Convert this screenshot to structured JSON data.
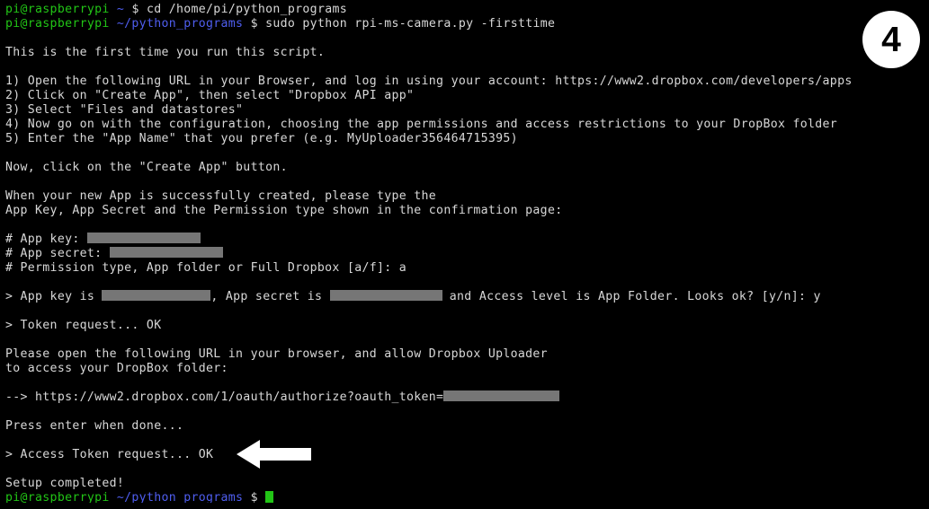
{
  "badge": {
    "label": "4"
  },
  "prompt": {
    "user": "pi@raspberrypi",
    "path_home": "~",
    "path_programs": "~/python_programs",
    "symbol": "$"
  },
  "commands": {
    "cd": "cd /home/pi/python_programs",
    "run": "sudo python rpi-ms-camera.py -firsttime"
  },
  "output": {
    "intro": "This is the first time you run this script.",
    "step1": "1) Open the following URL in your Browser, and log in using your account: https://www2.dropbox.com/developers/apps",
    "step2": "2) Click on \"Create App\", then select \"Dropbox API app\"",
    "step3": "3) Select \"Files and datastores\"",
    "step4": "4) Now go on with the configuration, choosing the app permissions and access restrictions to your DropBox folder",
    "step5": "5) Enter the \"App Name\" that you prefer (e.g. MyUploader356464715395)",
    "create_app": "Now, click on the \"Create App\" button.",
    "confirm_line1": "When your new App is successfully created, please type the",
    "confirm_line2": "App Key, App Secret and the Permission type shown in the confirmation page:",
    "app_key_label": "# App key: ",
    "app_secret_label": "# App secret: ",
    "permission_line": "# Permission type, App folder or Full Dropbox [a/f]: a",
    "summary_pre": "> App key is ",
    "summary_mid": ", App secret is ",
    "summary_post": " and Access level is App Folder. Looks ok? [y/n]: y",
    "token_request": "> Token request... OK",
    "browser_line1": "Please open the following URL in your browser, and allow Dropbox Uploader",
    "browser_line2": "to access your DropBox folder:",
    "auth_url": "--> https://www2.dropbox.com/1/oauth/authorize?oauth_token=",
    "press_enter": "Press enter when done...",
    "access_token": "> Access Token request... OK",
    "setup_completed": "Setup completed!"
  },
  "colors": {
    "background": "#000000",
    "text": "#d8d8d8",
    "user_green": "#22c516",
    "path_blue": "#4f5ef0",
    "redaction_gray": "#767676",
    "annotation_white": "#ffffff"
  }
}
